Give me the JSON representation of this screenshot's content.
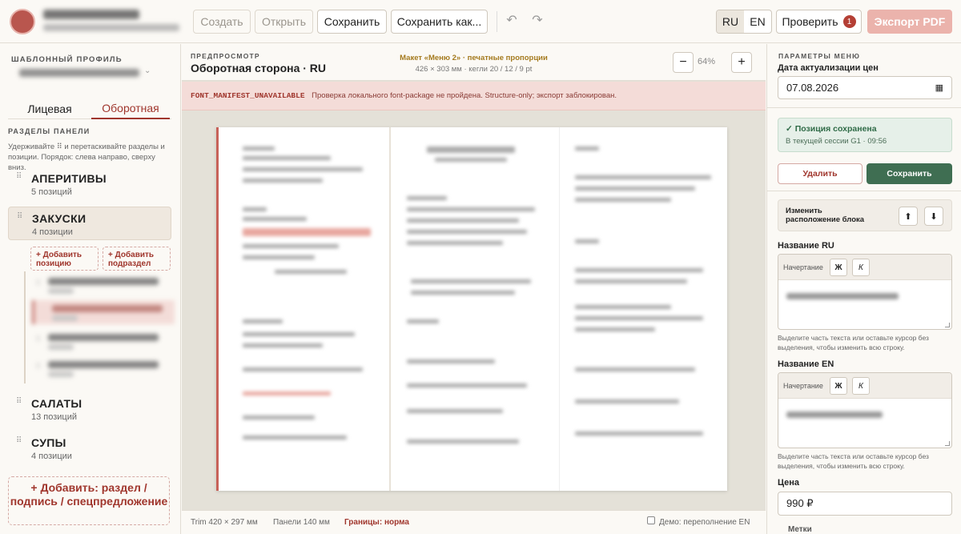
{
  "header": {
    "app_name": "Редактор меню",
    "app_subtitle": "G1 · Воспитательная шаблон меню",
    "create": "Создать",
    "open": "Открыть",
    "save": "Сохранить",
    "save_as": "Сохранить как...",
    "undo_icon": "undo-icon",
    "redo_icon": "redo-icon",
    "lang_ru": "RU",
    "lang_en": "EN",
    "check": "Проверить",
    "check_count": "1",
    "export": "Экспорт PDF"
  },
  "left": {
    "profile_caption": "ШАБЛОННЫЙ ПРОФИЛЬ",
    "profile_value": "Основное меню · Москва",
    "tab_front": "Лицевая",
    "tab_back": "Оборотная",
    "sections_caption": "РАЗДЕЛЫ ПАНЕЛИ",
    "hint": "Удерживайте ⠿ и перетаскивайте разделы и позиции. Порядок: слева направо, сверху вниз.",
    "sections": [
      {
        "name": "АПЕРИТИВЫ",
        "count": "5 позиций"
      },
      {
        "name": "ЗАКУСКИ",
        "count": "4 позиции"
      },
      {
        "name": "САЛАТЫ",
        "count": "13 позиций"
      },
      {
        "name": "СУПЫ",
        "count": "4 позиции"
      }
    ],
    "add_position": "+ Добавить позицию",
    "add_subsection": "+ Добавить подраздел",
    "add_big": "+ Добавить: раздел / подпись / спецпредложение"
  },
  "preview": {
    "caption": "ПРЕДПРОСМОТР",
    "title": "Оборотная сторона · RU",
    "layout_title": "Макет «Меню 2» · печатные пропорции",
    "layout_sub": "426 × 303 мм · кегли 20 / 12 / 9 pt",
    "zoom": "64%",
    "zoom_out": "−",
    "zoom_in": "+",
    "warn_code": "FONT_MANIFEST_UNAVAILABLE",
    "warn_msg": "Проверка локального font-package не пройдена. Structure-only; экспорт заблокирован.",
    "trim": "Trim 420 × 297 мм",
    "panels": "Панели 140 мм",
    "bounds": "Границы: норма",
    "demo": "Демо: переполнение EN"
  },
  "right": {
    "caption": "ПАРАМЕТРЫ МЕНЮ",
    "date_label": "Дата актуализации цен",
    "date_value": "07.08.2026",
    "saved_title": "✓ Позиция сохранена",
    "saved_sub": "В текущей сессии G1 · 09:56",
    "delete": "Удалить",
    "save": "Сохранить",
    "reorder": "Изменить расположение блока",
    "name_ru_label": "Название RU",
    "name_en_label": "Название EN",
    "style_label": "Начертание",
    "bold": "Ж",
    "italic": "К",
    "help": "Выделите часть текста или оставьте курсор без выделения, чтобы изменить всю строку.",
    "price_label": "Цена",
    "price_value": "990 ₽",
    "tags_label": "Метки"
  }
}
